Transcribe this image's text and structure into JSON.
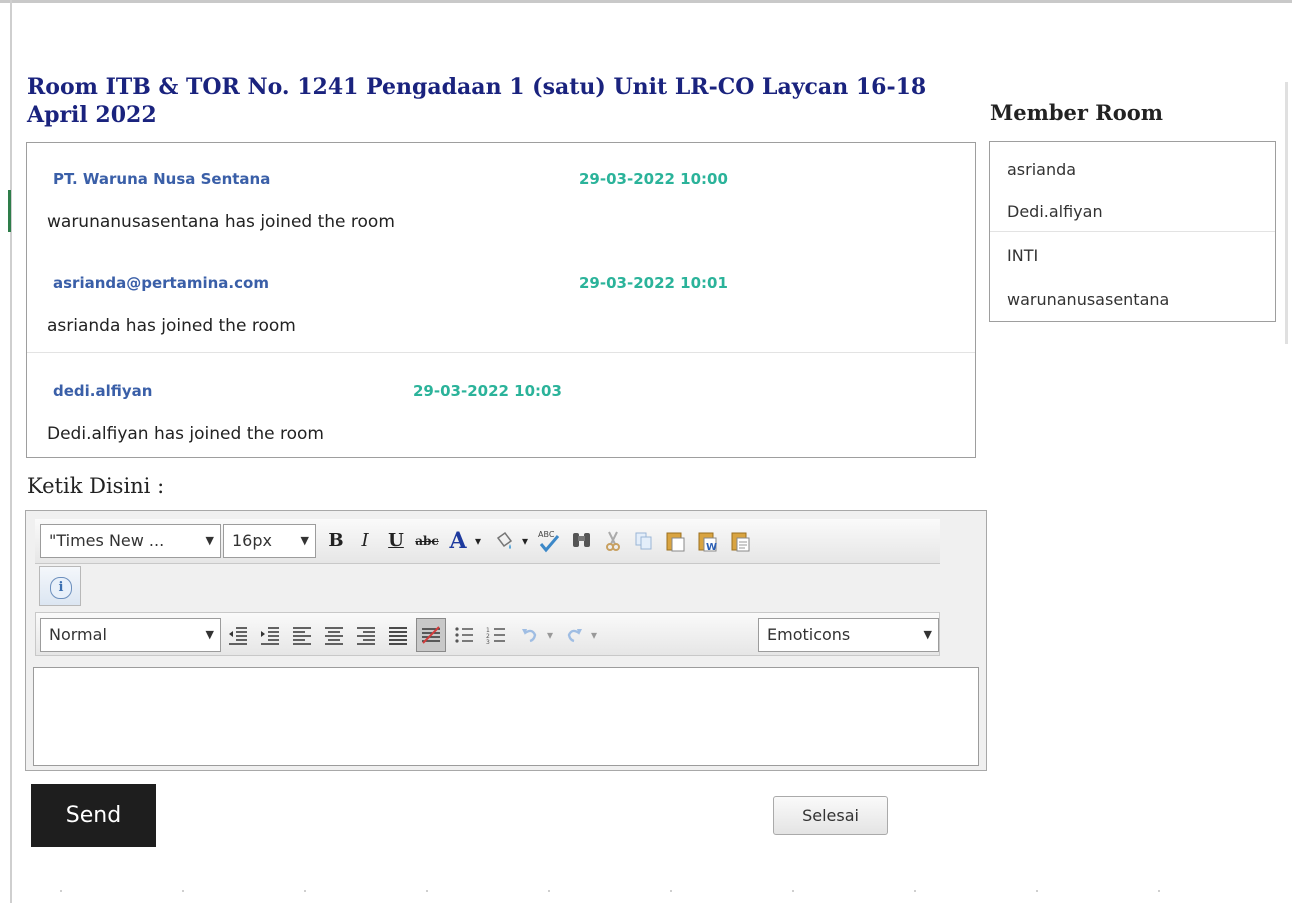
{
  "room": {
    "title": "Room ITB & TOR No. 1241 Pengadaan 1 (satu) Unit LR-CO Laycan 16-18 April 2022"
  },
  "messages": [
    {
      "sender": "PT. Waruna Nusa Sentana",
      "time": "29-03-2022 10:00",
      "text": "warunanusasentana has joined the room"
    },
    {
      "sender": "asrianda@pertamina.com",
      "time": "29-03-2022 10:01",
      "text": "asrianda has joined the room"
    },
    {
      "sender": "dedi.alfiyan",
      "time": "29-03-2022 10:03",
      "text": "Dedi.alfiyan has joined the room"
    }
  ],
  "members": {
    "title": "Member Room",
    "items": [
      "asrianda",
      "Dedi.alfiyan",
      "INTI",
      "warunanusasentana"
    ]
  },
  "composer": {
    "label": "Ketik Disini :",
    "font_family_value": "\"Times New ...",
    "font_size_value": "16px",
    "format_value": "Normal",
    "emoticons_value": "Emoticons",
    "content": ""
  },
  "toolbar": {
    "bold": "B",
    "italic": "I",
    "underline": "U",
    "strike": "abc",
    "font_color": "A",
    "info": "i"
  },
  "icons": {
    "highlight": "paint-bucket-icon",
    "spellcheck": "spellcheck-icon",
    "find": "binoculars-icon",
    "cut": "scissors-icon",
    "copy": "copy-icon",
    "paste": "paste-icon",
    "paste_word": "paste-word-icon",
    "paste_text": "paste-text-icon",
    "outdent": "outdent-icon",
    "indent": "indent-icon",
    "justify_left": "align-left-icon",
    "justify_center": "align-center-icon",
    "justify_right": "align-right-icon",
    "justify_full": "align-justify-icon",
    "remove_format": "remove-format-icon",
    "bullet_list": "bullet-list-icon",
    "number_list": "numbered-list-icon",
    "undo": "undo-icon",
    "redo": "redo-icon"
  },
  "buttons": {
    "send": "Send",
    "finish": "Selesai"
  },
  "colors": {
    "title": "#1a237e",
    "sender": "#3a5fa8",
    "timestamp": "#2bb39a",
    "send_button": "#1e1e1e"
  }
}
